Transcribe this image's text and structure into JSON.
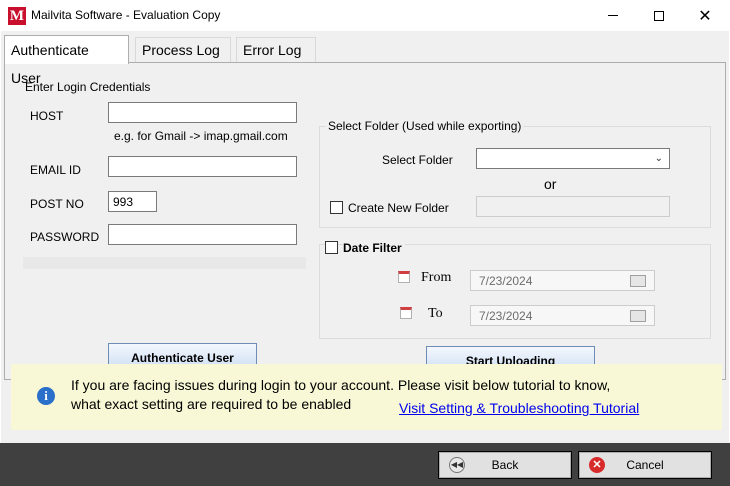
{
  "window": {
    "title": "Mailvita Software - Evaluation Copy",
    "logo_letter": "M",
    "min_icon": "minimize-icon",
    "max_icon": "maximize-icon",
    "close_glyph": "✕"
  },
  "tabs": [
    {
      "label": "Authenticate User",
      "active": true
    },
    {
      "label": "Process Log",
      "active": false
    },
    {
      "label": "Error Log",
      "active": false
    }
  ],
  "credentials": {
    "group_title": "Enter Login Credentials",
    "host_label": "HOST",
    "host_value": "",
    "host_hint": "e.g. for Gmail -> imap.gmail.com",
    "email_label": "EMAIL ID",
    "email_value": "",
    "port_label": "POST NO",
    "port_value": "993",
    "password_label": "PASSWORD",
    "password_value": "",
    "authenticate_button": "Authenticate User"
  },
  "folder": {
    "group_title": "Select Folder (Used while exporting)",
    "select_label": "Select Folder",
    "select_value": "",
    "or_text": "or",
    "create_label": "Create New Folder",
    "create_checked": false,
    "new_folder_value": ""
  },
  "date_filter": {
    "label": "Date Filter",
    "checked": false,
    "from_label": "From",
    "from_value": "7/23/2024",
    "to_label": "To",
    "to_value": "7/23/2024"
  },
  "start_button": "Start Uploading",
  "info": {
    "icon": "info-icon",
    "line1": "If you are facing issues during login to your account. Please visit below tutorial to know,",
    "line2": "what exact setting are required to be enabled",
    "link_text": "Visit Setting & Troubleshooting Tutorial"
  },
  "footer": {
    "back_label": "Back",
    "cancel_label": "Cancel"
  },
  "colors": {
    "info_bg": "#f8f8d6",
    "footer_bg": "#404040",
    "link": "#0000ee",
    "logo": "#c8102e"
  }
}
